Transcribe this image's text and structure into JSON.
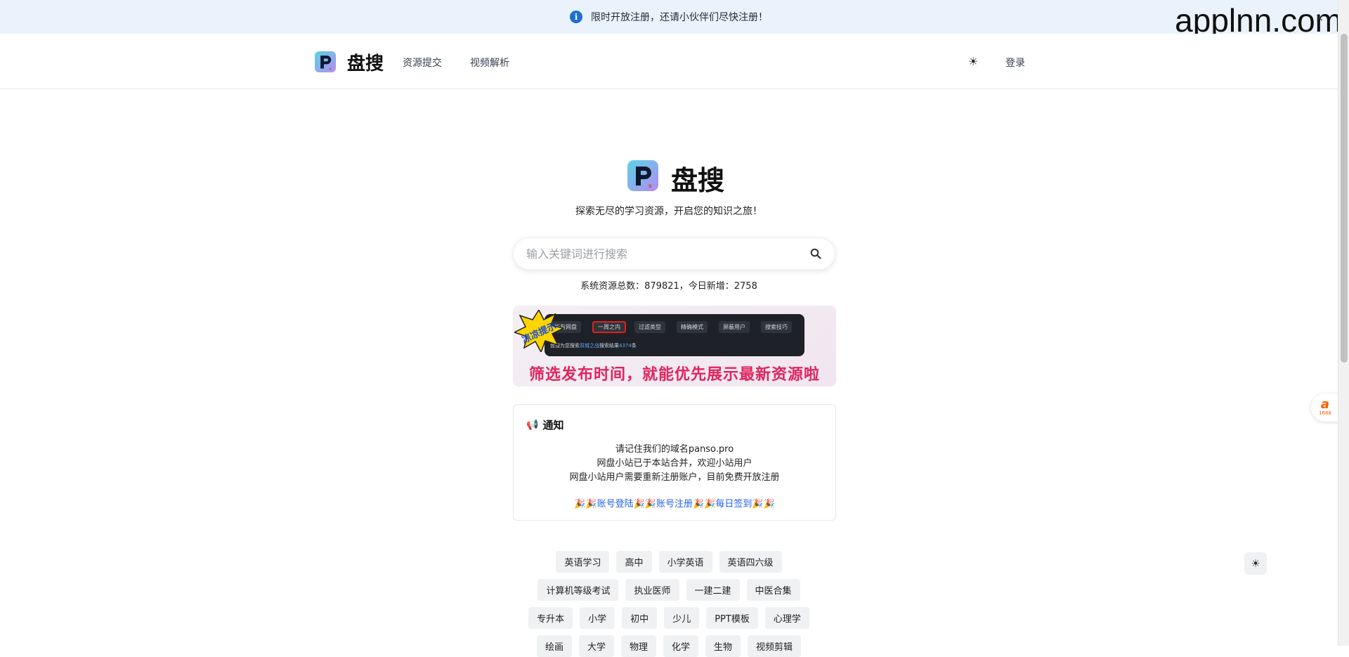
{
  "announcement": {
    "text": "限时开放注册，还请小伙伴们尽快注册！",
    "icon": "info-icon"
  },
  "watermark": {
    "text": "applnn.com",
    "close": "×"
  },
  "header": {
    "brand": "盘搜",
    "nav": [
      {
        "label": "资源提交"
      },
      {
        "label": "视频解析"
      }
    ],
    "theme_icon": "sun-icon",
    "login": "登录"
  },
  "hero": {
    "brand": "盘搜",
    "tagline": "探索无尽的学习资源，开启您的知识之旅！",
    "search": {
      "placeholder": "输入关键词进行搜索",
      "value": ""
    },
    "stats": "系统资源总数：879821，今日新增：2758"
  },
  "banner": {
    "burst_text": "凉凉提示",
    "chips": [
      "所有网盘",
      "一周之内",
      "过滤类型",
      "精确模式",
      "屏蔽用户",
      "搜索技巧"
    ],
    "caption_prefix": "盘搜为您搜索",
    "caption_highlight": "双城之战",
    "caption_mid": "搜索结果",
    "caption_count": "4374",
    "caption_suffix": "条",
    "slogan": "筛选发布时间，就能优先展示最新资源啦"
  },
  "notice": {
    "title": "通知",
    "lines": [
      "请记住我们的域名panso.pro",
      "网盘小站已于本站合并，欢迎小站用户",
      "网盘小站用户需要重新注册账户，目前免费开放注册"
    ],
    "links": [
      "账号登陆",
      "账号注册",
      "每日签到"
    ]
  },
  "tags": [
    [
      "英语学习",
      "高中",
      "小学英语",
      "英语四六级"
    ],
    [
      "计算机等级考试",
      "执业医师",
      "一建二建",
      "中医合集"
    ],
    [
      "专升本",
      "小学",
      "初中",
      "少儿",
      "PPT模板",
      "心理学"
    ],
    [
      "绘画",
      "大学",
      "物理",
      "化学",
      "生物",
      "视频剪辑"
    ]
  ],
  "side_badge": {
    "label": "1688"
  },
  "colors": {
    "accent": "#2563eb",
    "slogan": "#e0245e",
    "announcement_bg": "#eaf3fb"
  }
}
